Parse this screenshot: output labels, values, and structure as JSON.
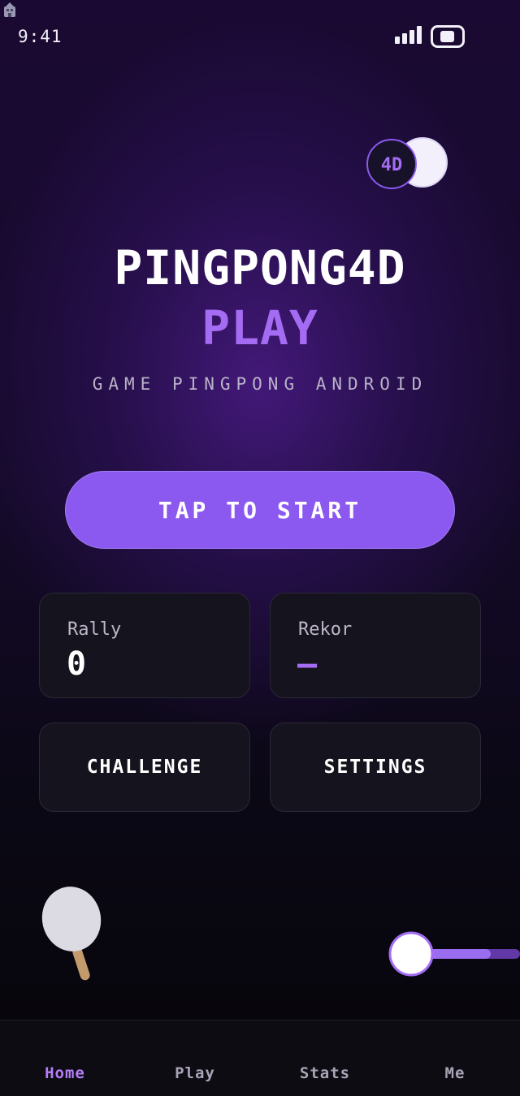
{
  "status_bar": {
    "time": "9:41",
    "icons": [
      "signal-icon",
      "battery-icon"
    ]
  },
  "logo": {
    "text": "4D"
  },
  "header": {
    "title": "PINGPONG4D",
    "subtitle": "PLAY",
    "tagline": "GAME PINGPONG ANDROID"
  },
  "start_button": {
    "label": "TAP TO START"
  },
  "stats": [
    {
      "label": "Rally",
      "value": "0"
    },
    {
      "label": "Rekor",
      "value": "—"
    }
  ],
  "menu": [
    {
      "label": "CHALLENGE"
    },
    {
      "label": "SETTINGS"
    }
  ],
  "decor": {
    "icons": [
      "paddle-icon",
      "ball-icon"
    ]
  },
  "nav": [
    {
      "label": "Home",
      "active": true
    },
    {
      "label": "Play",
      "active": false
    },
    {
      "label": "Stats",
      "active": false
    },
    {
      "label": "Me",
      "active": false
    }
  ],
  "colors": {
    "accent": "#8b59ef",
    "accent_text": "#a46cf3",
    "nav_active": "#b57ef8",
    "card_bg": "#15131d",
    "background": "#07060b"
  }
}
